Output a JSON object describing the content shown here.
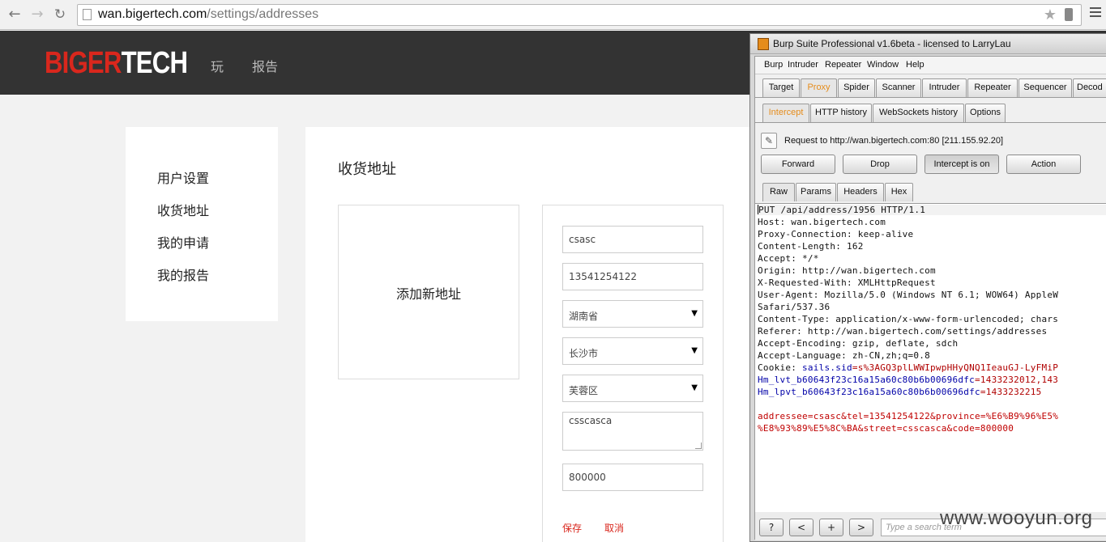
{
  "browser": {
    "url_host": "wan.bigertech.com",
    "url_path": "/settings/addresses"
  },
  "site": {
    "logo_red": "BIGER",
    "logo_white": "TECH",
    "nav": [
      "玩",
      "报告"
    ]
  },
  "sidebar": {
    "items": [
      "用户设置",
      "收货地址",
      "我的申请",
      "我的报告"
    ]
  },
  "main": {
    "title": "收货地址",
    "add_new_label": "添加新地址",
    "form": {
      "name": "csasc",
      "phone": "13541254122",
      "province": "湖南省",
      "city": "长沙市",
      "district": "芙蓉区",
      "street": "csscasca",
      "code": "800000",
      "save_label": "保存",
      "cancel_label": "取消"
    }
  },
  "burp": {
    "title": "Burp Suite Professional v1.6beta - licensed to LarryLau",
    "menu": [
      "Burp",
      "Intruder",
      "Repeater",
      "Window",
      "Help"
    ],
    "tabs": [
      "Target",
      "Proxy",
      "Spider",
      "Scanner",
      "Intruder",
      "Repeater",
      "Sequencer",
      "Decod"
    ],
    "active_tab": "Proxy",
    "subtabs": [
      "Intercept",
      "HTTP history",
      "WebSockets history",
      "Options"
    ],
    "active_subtab": "Intercept",
    "request_label": "Request to http://wan.bigertech.com:80  [211.155.92.20]",
    "buttons": [
      "Forward",
      "Drop",
      "Intercept is on",
      "Action"
    ],
    "viewtabs": [
      "Raw",
      "Params",
      "Headers",
      "Hex"
    ],
    "active_viewtab": "Raw",
    "request_lines": [
      "PUT /api/address/1956 HTTP/1.1",
      "Host: wan.bigertech.com",
      "Proxy-Connection: keep-alive",
      "Content-Length: 162",
      "Accept: */*",
      "Origin: http://wan.bigertech.com",
      "X-Requested-With: XMLHttpRequest",
      "User-Agent: Mozilla/5.0 (Windows NT 6.1; WOW64) AppleW",
      "Safari/537.36",
      "Content-Type: application/x-www-form-urlencoded; chars",
      "Referer: http://wan.bigertech.com/settings/addresses",
      "Accept-Encoding: gzip, deflate, sdch",
      "Accept-Language: zh-CN,zh;q=0.8"
    ],
    "cookie_name": "Cookie: ",
    "cookie_k1": "sails.sid",
    "cookie_v1": "=s%3AGQ3plLWWIpwpHHyQNQ1IeauGJ-LyFMiP",
    "cookie_k2": "Hm_lvt_b60643f23c16a15a60c80b6b00696dfc",
    "cookie_v2": "=1433232012,143",
    "cookie_k3": "Hm_lpvt_b60643f23c16a15a60c80b6b00696dfc",
    "cookie_v3": "=1433232215",
    "body_line1": "addressee=csasc&tel=13541254122&province=%E6%B9%96%E5%",
    "body_line2": "%E8%93%89%E5%8C%BA&street=csscasca&code=800000",
    "bottom_buttons": [
      "?",
      "<",
      "+",
      ">"
    ],
    "search_placeholder": "Type a search term"
  },
  "watermark": "www.wooyun.org"
}
